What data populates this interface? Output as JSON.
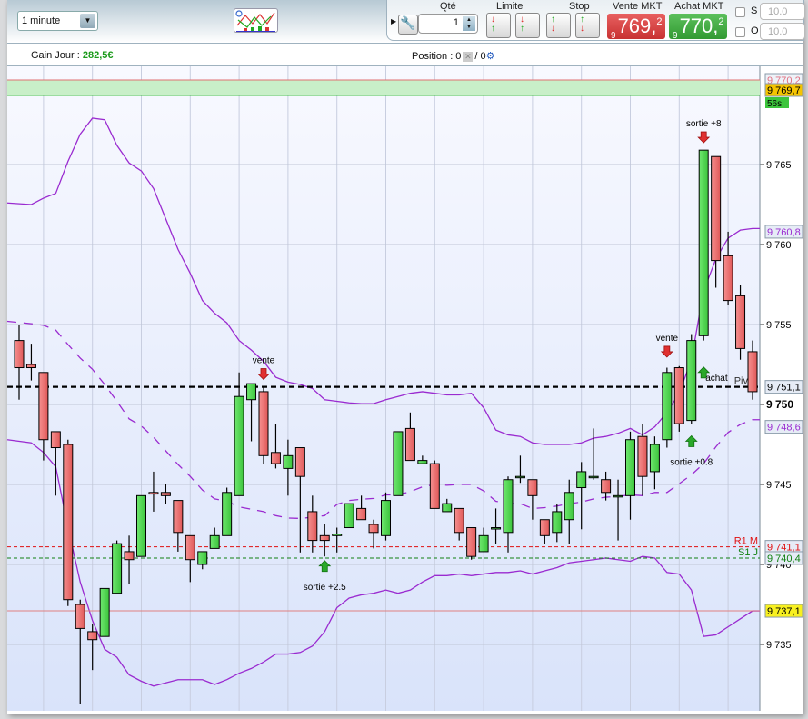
{
  "toolbar": {
    "timeframe": "1 minute",
    "qty_label": "Qté",
    "qty_value": "1",
    "limit_label": "Limite",
    "stop_label": "Stop",
    "sell_label": "Vente MKT",
    "sell_prefix": "9",
    "sell_price": "769,",
    "sell_decimal": "2",
    "buy_label": "Achat MKT",
    "buy_prefix": "9",
    "buy_price": "770,",
    "buy_decimal": "2",
    "check_s": "S",
    "check_o": "O",
    "input_s": "10.0",
    "input_o": "10.0"
  },
  "info": {
    "gain_label": "Gain Jour : ",
    "gain_value": "282,5€",
    "position_label": "Position : 0",
    "position_sep": "/ 0"
  },
  "colors": {
    "up": "#4fd44f",
    "down": "#ee6b6b",
    "band": "#9a2bd0",
    "sell": "#d83a3a",
    "buy": "#3aa83a"
  },
  "chart_data": {
    "type": "candlestick",
    "ylim": [
      9730.5,
      9771
    ],
    "yticks": [
      9735,
      9740,
      9745,
      9750,
      9755,
      9760,
      9765
    ],
    "ytick_labels": [
      "9 735",
      "9 740",
      "9 745",
      "9 750",
      "9 755",
      "9 760",
      "9 765"
    ],
    "candles": [
      [
        9754.0,
        9755.0,
        9750.3,
        9752.3
      ],
      [
        9752.5,
        9753.8,
        9751.5,
        9752.3
      ],
      [
        9752.0,
        9752.0,
        9746.5,
        9747.8
      ],
      [
        9748.3,
        9748.3,
        9744.3,
        9747.3
      ],
      [
        9747.5,
        9747.8,
        9737.4,
        9737.8
      ],
      [
        9737.5,
        9737.8,
        9731.25,
        9736.0
      ],
      [
        9735.8,
        9736.3,
        9733.4,
        9735.3
      ],
      [
        9735.5,
        9738.5,
        9735.5,
        9738.5
      ],
      [
        9738.2,
        9741.5,
        9738.2,
        9741.3
      ],
      [
        9740.8,
        9741.8,
        9738.75,
        9740.3
      ],
      [
        9740.5,
        9744.3,
        9740.5,
        9744.3
      ],
      [
        9744.5,
        9745.8,
        9743.3,
        9744.4
      ],
      [
        9744.5,
        9745.0,
        9743.75,
        9744.3
      ],
      [
        9744.0,
        9744.0,
        9740.8,
        9742.0
      ],
      [
        9741.8,
        9741.8,
        9738.9,
        9740.3
      ],
      [
        9740.0,
        9740.8,
        9739.7,
        9740.8
      ],
      [
        9741.0,
        9742.3,
        9741.0,
        9741.8
      ],
      [
        9741.8,
        9744.8,
        9741.8,
        9744.5
      ],
      [
        9744.3,
        9752.0,
        9744.3,
        9750.5
      ],
      [
        9750.3,
        9751.3,
        9747.7,
        9751.3
      ],
      [
        9750.8,
        9751.1,
        9746.25,
        9746.8
      ],
      [
        9747.0,
        9748.8,
        9746.0,
        9746.3
      ],
      [
        9746.0,
        9747.8,
        9744.3,
        9746.8
      ],
      [
        9747.3,
        9747.3,
        9740.75,
        9745.5
      ],
      [
        9743.3,
        9744.3,
        9740.75,
        9741.5
      ],
      [
        9741.8,
        9742.5,
        9740.5,
        9741.5
      ],
      [
        9741.8,
        9742.3,
        9740.75,
        9741.9
      ],
      [
        9742.3,
        9743.8,
        9742.3,
        9743.8
      ],
      [
        9743.5,
        9744.3,
        9742.8,
        9742.8
      ],
      [
        9742.5,
        9742.8,
        9741.0,
        9742.0
      ],
      [
        9741.8,
        9744.5,
        9741.5,
        9744.0
      ],
      [
        9744.3,
        9748.3,
        9744.3,
        9748.3
      ],
      [
        9748.5,
        9749.5,
        9746.5,
        9746.5
      ],
      [
        9746.3,
        9746.8,
        9746.3,
        9746.5
      ],
      [
        9746.3,
        9746.5,
        9743.5,
        9743.5
      ],
      [
        9743.3,
        9744.1,
        9743.3,
        9743.8
      ],
      [
        9743.5,
        9743.5,
        9741.5,
        9742.0
      ],
      [
        9742.3,
        9742.3,
        9740.3,
        9740.5
      ],
      [
        9740.8,
        9742.3,
        9740.8,
        9741.8
      ],
      [
        9742.3,
        9743.5,
        9741.3,
        9742.3
      ],
      [
        9742.0,
        9745.5,
        9740.75,
        9745.3
      ],
      [
        9745.5,
        9746.8,
        9745.1,
        9745.5
      ],
      [
        9745.3,
        9745.3,
        9742.8,
        9744.3
      ],
      [
        9742.8,
        9742.8,
        9741.3,
        9741.8
      ],
      [
        9742.0,
        9743.8,
        9741.4,
        9743.3
      ],
      [
        9742.8,
        9745.3,
        9741.25,
        9744.5
      ],
      [
        9744.8,
        9746.4,
        9742.2,
        9745.8
      ],
      [
        9745.5,
        9748.5,
        9745.3,
        9745.5
      ],
      [
        9745.3,
        9745.8,
        9744.0,
        9744.5
      ],
      [
        9744.3,
        9745.3,
        9741.5,
        9744.3
      ],
      [
        9744.3,
        9748.3,
        9742.8,
        9747.8
      ],
      [
        9748.0,
        9748.8,
        9744.3,
        9745.5
      ],
      [
        9745.8,
        9748.0,
        9744.7,
        9747.5
      ],
      [
        9747.8,
        9752.3,
        9747.3,
        9752.0
      ],
      [
        9752.3,
        9752.4,
        9748.3,
        9748.8
      ],
      [
        9749.0,
        9754.4,
        9748.75,
        9754.0
      ],
      [
        9754.3,
        9765.9,
        9754.0,
        9765.9
      ],
      [
        9765.5,
        9765.5,
        9757.3,
        9759.0
      ],
      [
        9759.3,
        9760.8,
        9756.25,
        9756.5
      ],
      [
        9756.8,
        9757.5,
        9752.8,
        9753.5
      ],
      [
        9753.3,
        9754.0,
        9750.3,
        9750.8
      ]
    ],
    "upper_band": [
      9762.6,
      9762.5,
      9762.9,
      9763.2,
      9765.2,
      9766.9,
      9767.9,
      9767.8,
      9766.2,
      9765.1,
      9764.6,
      9763.5,
      9761.6,
      9759.7,
      9758.2,
      9756.5,
      9755.7,
      9755.1,
      9754.0,
      9753.4,
      9752.7,
      9751.7,
      9751.4,
      9751.25,
      9751.0,
      9750.3,
      9750.2,
      9750.1,
      9750.05,
      9750.05,
      9750.3,
      9750.5,
      9750.7,
      9750.8,
      9750.7,
      9750.6,
      9750.6,
      9750.7,
      9749.8,
      9748.4,
      9748.1,
      9748.0,
      9747.6,
      9747.5,
      9747.5,
      9747.5,
      9747.6,
      9747.9,
      9748.0,
      9748.2,
      9748.5,
      9748.1,
      9748.6,
      9749.5,
      9750.7,
      9752.8,
      9757.1,
      9759.1,
      9760.4,
      9760.9,
      9761.0
    ],
    "lower_band": [
      9747.8,
      9747.6,
      9747.0,
      9746.1,
      9742.3,
      9738.9,
      9736.5,
      9734.7,
      9734.2,
      9733.1,
      9732.7,
      9732.4,
      9732.6,
      9732.8,
      9732.8,
      9732.8,
      9732.5,
      9732.8,
      9733.2,
      9733.5,
      9733.9,
      9734.4,
      9734.4,
      9734.5,
      9734.9,
      9735.8,
      9737.3,
      9737.9,
      9738.1,
      9738.2,
      9738.4,
      9738.2,
      9738.4,
      9738.9,
      9739.3,
      9739.3,
      9739.4,
      9739.3,
      9739.4,
      9739.5,
      9739.5,
      9739.6,
      9739.4,
      9739.6,
      9739.8,
      9740.1,
      9740.2,
      9740.3,
      9740.4,
      9740.3,
      9740.2,
      9740.5,
      9740.4,
      9739.5,
      9739.4,
      9738.4,
      9735.5,
      9735.6,
      9736.1,
      9736.6,
      9737.1
    ],
    "levels": [
      {
        "name": "Piv H",
        "price": 9751.1,
        "label": "9 751,1",
        "color": "#000000",
        "style": "dash-bold"
      },
      {
        "name": "R1 M",
        "price": 9741.1,
        "label": "9 741,1",
        "color": "#e01010",
        "style": "dash"
      },
      {
        "name": "S1 J",
        "price": 9740.4,
        "label": "9 740,4",
        "color": "#108010",
        "style": "dash"
      },
      {
        "name": "",
        "price": 9737.1,
        "label": "9 737,1",
        "color": "#e08080",
        "style": "solid"
      }
    ],
    "band_tags": [
      {
        "price": 9760.8,
        "label": "9 760,8"
      },
      {
        "price": 9748.6,
        "label": "9 748,6"
      }
    ],
    "zone": {
      "top": 9770.2,
      "bottom": 9769.7,
      "top_label": "9 770,2",
      "bottom_label": "9 769,7",
      "timer": "56s"
    },
    "markers": [
      {
        "candle": 20,
        "price": 9751.9,
        "dir": "down",
        "label": "vente",
        "label_pos": "above"
      },
      {
        "candle": 25,
        "price": 9739.9,
        "dir": "up",
        "label": "sortie +2.5",
        "label_pos": "below"
      },
      {
        "candle": 53,
        "price": 9753.3,
        "dir": "down",
        "label": "vente",
        "label_pos": "above"
      },
      {
        "candle": 55,
        "price": 9747.7,
        "dir": "up",
        "label": "sortie +0.8",
        "label_pos": "below"
      },
      {
        "candle": 56,
        "price": 9752.0,
        "dir": "up",
        "label": "achat",
        "label_pos": "right"
      },
      {
        "candle": 56,
        "price": 9766.7,
        "dir": "down",
        "label": "sortie +8",
        "label_pos": "above"
      }
    ]
  }
}
